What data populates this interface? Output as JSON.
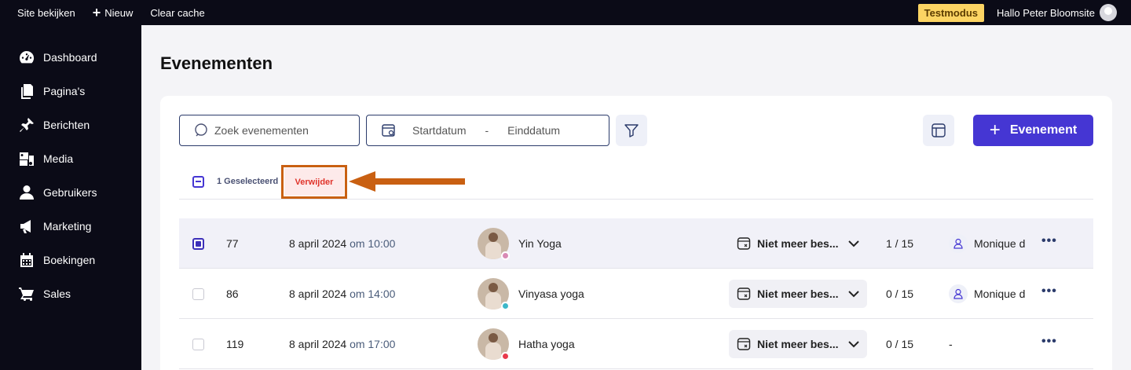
{
  "topbar": {
    "view_site": "Site bekijken",
    "new": "Nieuw",
    "clear_cache": "Clear cache",
    "test_mode": "Testmodus",
    "greeting": "Hallo Peter Bloomsite"
  },
  "sidebar": {
    "items": [
      {
        "label": "Dashboard",
        "icon": "dashboard-icon"
      },
      {
        "label": "Pagina's",
        "icon": "pages-icon"
      },
      {
        "label": "Berichten",
        "icon": "pin-icon"
      },
      {
        "label": "Media",
        "icon": "media-icon"
      },
      {
        "label": "Gebruikers",
        "icon": "user-icon"
      },
      {
        "label": "Marketing",
        "icon": "megaphone-icon"
      },
      {
        "label": "Boekingen",
        "icon": "calendar-icon"
      },
      {
        "label": "Sales",
        "icon": "cart-icon"
      }
    ]
  },
  "main": {
    "title": "Evenementen",
    "search_placeholder": "Zoek evenementen",
    "start_date": "Startdatum",
    "date_separator": "-",
    "end_date": "Einddatum",
    "add_button": "Evenement",
    "selected_count": "1 Geselecteerd",
    "delete_button": "Verwijder"
  },
  "colors": {
    "accent": "#4536d3",
    "highlight": "#c96012",
    "danger": "#e0342b"
  },
  "events": [
    {
      "id": "77",
      "date": "8 april 2024",
      "time": "om 10:00",
      "name": "Yin Yoga",
      "dot_color": "#d98bb5",
      "status": "Niet meer bes...",
      "capacity": "1 / 15",
      "teacher": "Monique d",
      "selected": true
    },
    {
      "id": "86",
      "date": "8 april 2024",
      "time": "om 14:00",
      "name": "Vinyasa yoga",
      "dot_color": "#3db8c9",
      "status": "Niet meer bes...",
      "capacity": "0 / 15",
      "teacher": "Monique d",
      "selected": false
    },
    {
      "id": "119",
      "date": "8 april 2024",
      "time": "om 17:00",
      "name": "Hatha yoga",
      "dot_color": "#e93a4c",
      "status": "Niet meer bes...",
      "capacity": "0 / 15",
      "teacher": "-",
      "selected": false
    }
  ]
}
